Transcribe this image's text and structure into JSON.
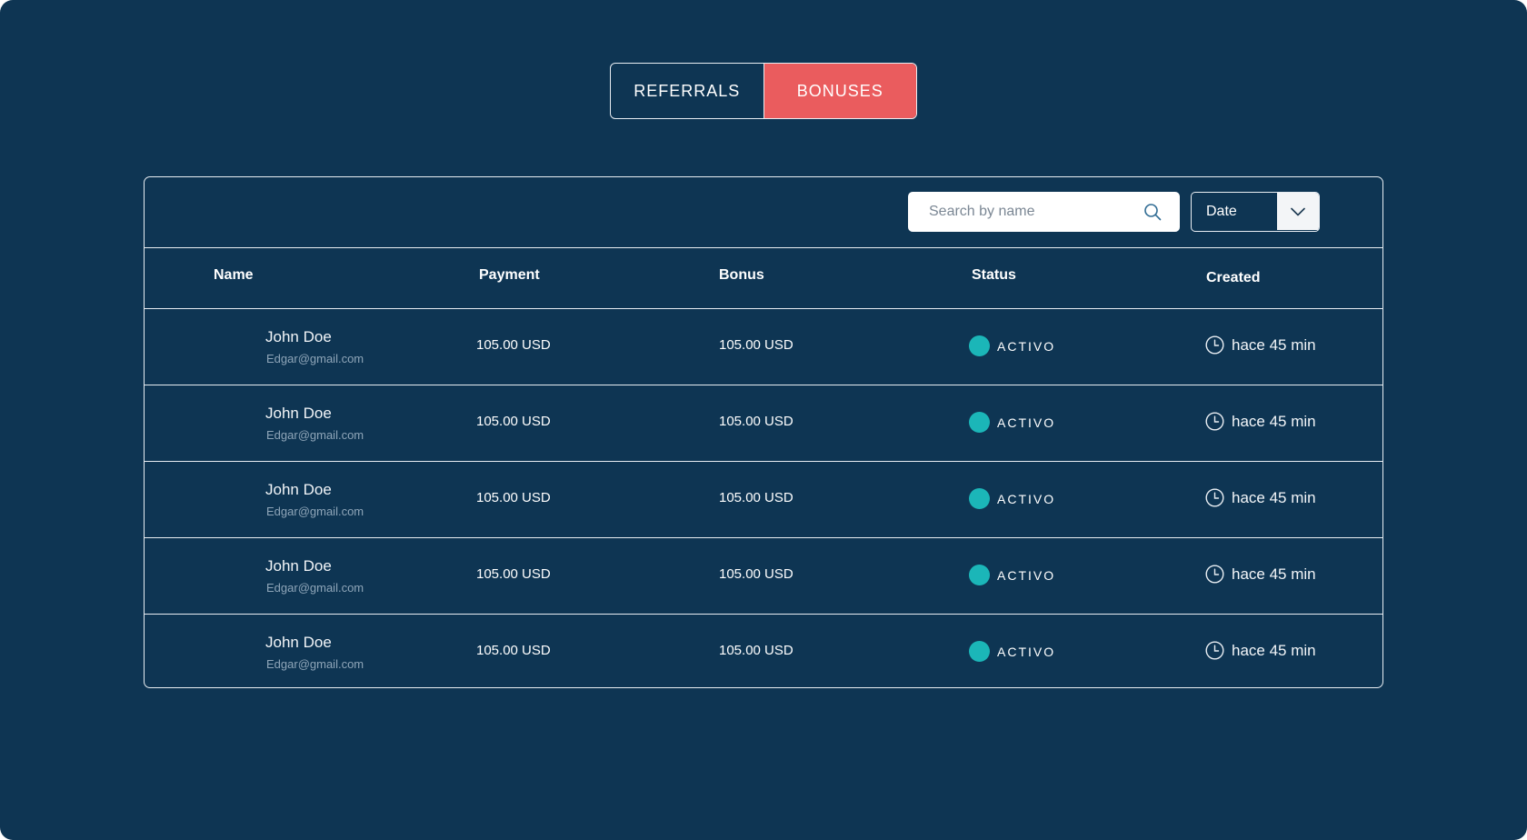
{
  "tabs": [
    {
      "label": "REFERRALS",
      "active": false
    },
    {
      "label": "BONUSES",
      "active": true
    }
  ],
  "toolbar": {
    "search_placeholder": "Search by name",
    "search_icon": "search-icon",
    "sort_select_value": "Date",
    "sort_icon": "chevron-down-icon"
  },
  "table": {
    "columns": [
      "Name",
      "Payment",
      "Bonus",
      "Status",
      "Created"
    ],
    "rows": [
      {
        "name": "John Doe",
        "email": "Edgar@gmail.com",
        "payment": "105.00 USD",
        "bonus": "105.00 USD",
        "status": "ACTIVO",
        "created": "hace 45 min"
      },
      {
        "name": "John Doe",
        "email": "Edgar@gmail.com",
        "payment": "105.00 USD",
        "bonus": "105.00 USD",
        "status": "ACTIVO",
        "created": "hace 45 min"
      },
      {
        "name": "John Doe",
        "email": "Edgar@gmail.com",
        "payment": "105.00 USD",
        "bonus": "105.00 USD",
        "status": "ACTIVO",
        "created": "hace 45 min"
      },
      {
        "name": "John Doe",
        "email": "Edgar@gmail.com",
        "payment": "105.00 USD",
        "bonus": "105.00 USD",
        "status": "ACTIVO",
        "created": "hace 45 min"
      },
      {
        "name": "John Doe",
        "email": "Edgar@gmail.com",
        "payment": "105.00 USD",
        "bonus": "105.00 USD",
        "status": "ACTIVO",
        "created": "hace 45 min"
      }
    ]
  },
  "colors": {
    "background": "#0e3553",
    "accent": "#ea5c5e",
    "status_active": "#1bb6b8",
    "border": "#e9eef3"
  }
}
